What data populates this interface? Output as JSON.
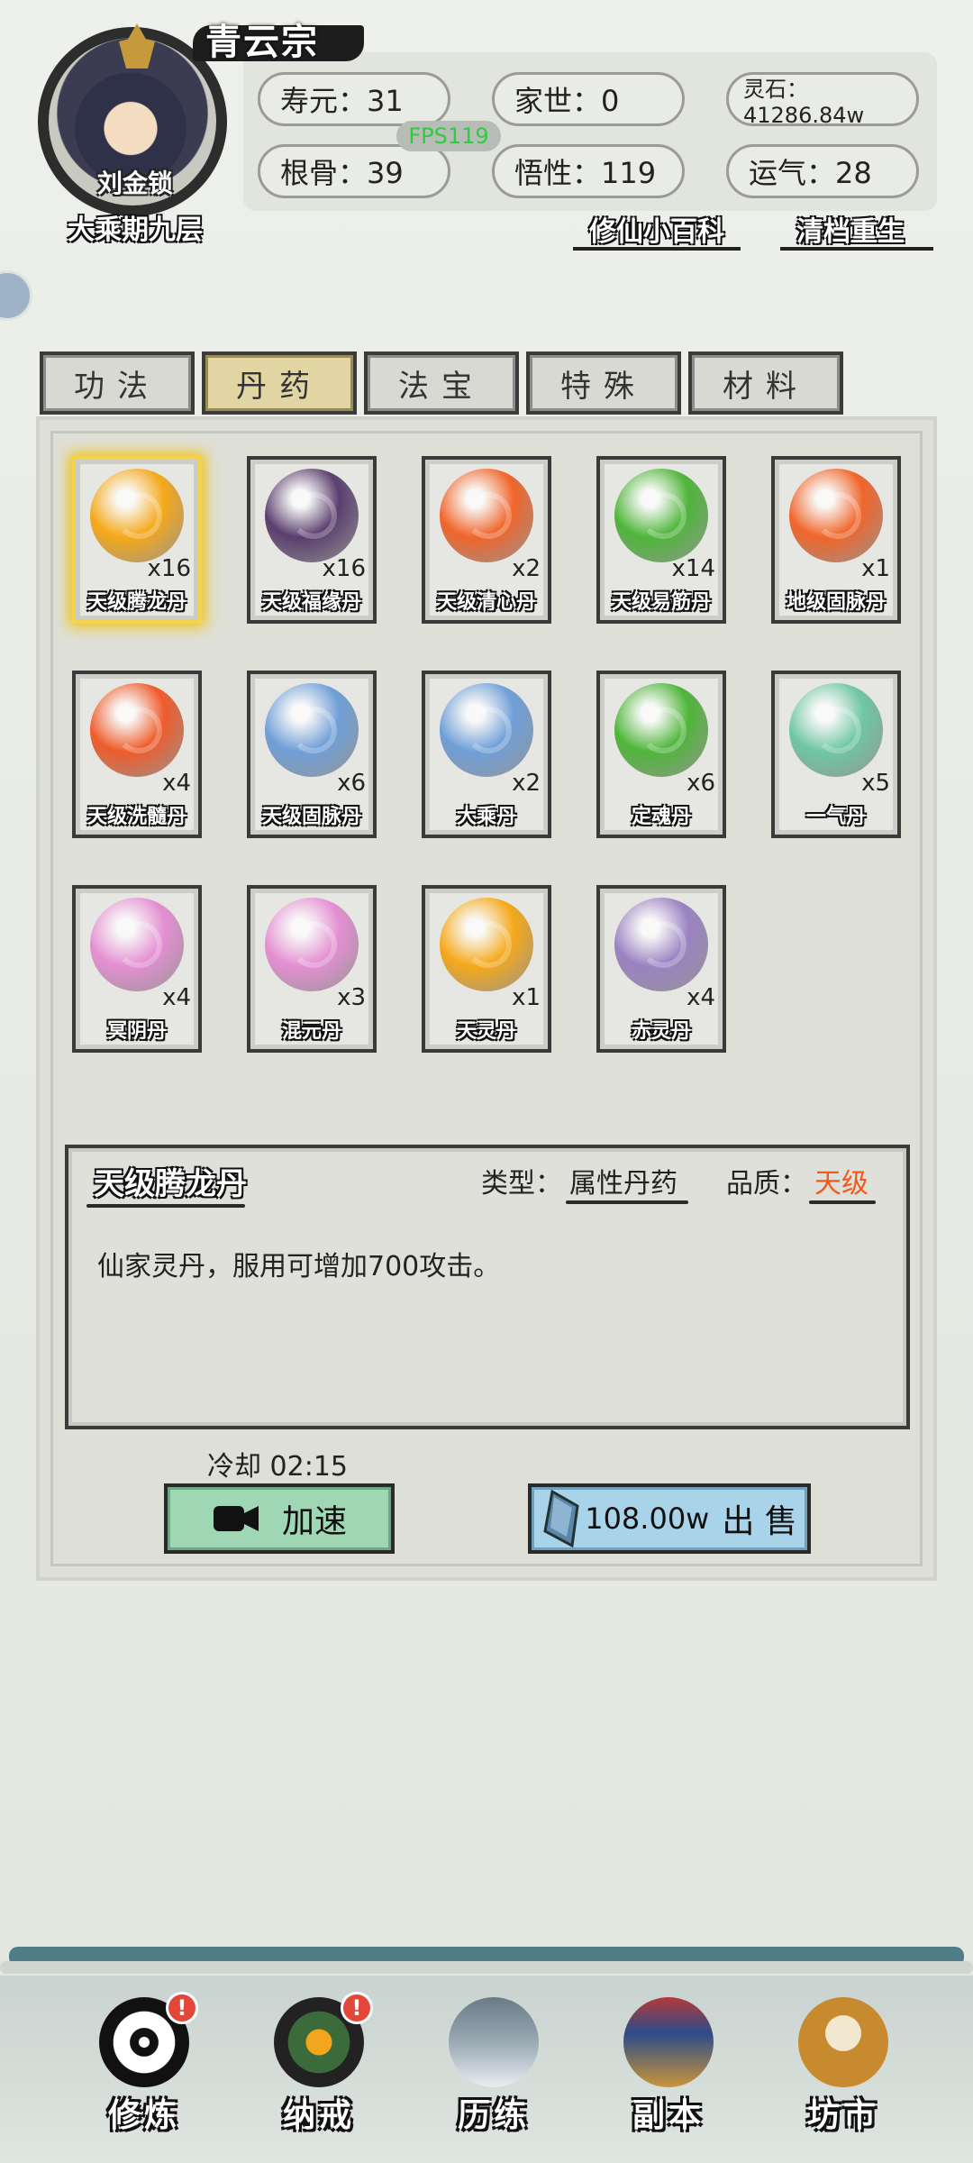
{
  "player": {
    "sect": "青云宗",
    "name": "刘金锁",
    "realm": "大乘期九层",
    "stats": {
      "lifespan": "寿元：31",
      "family": "家世：0",
      "spirit_stone": "灵石：41286.84w",
      "root": "根骨：39",
      "insight": "悟性：119",
      "luck": "运气：28"
    },
    "fps": "FPS119"
  },
  "links": {
    "encyclopedia": "修仙小百科",
    "reset": "清档重生"
  },
  "tabs": [
    "功法",
    "丹药",
    "法宝",
    "特殊",
    "材料"
  ],
  "active_tab": "丹药",
  "items": [
    {
      "name": "天级腾龙丹",
      "qty": "x16",
      "color": "#f5a81a"
    },
    {
      "name": "天级福缘丹",
      "qty": "x16",
      "color": "#5a3f6e"
    },
    {
      "name": "天级清心丹",
      "qty": "x2",
      "color": "#f0652a"
    },
    {
      "name": "天级易筋丹",
      "qty": "x14",
      "color": "#4fb53a"
    },
    {
      "name": "地级固脉丹",
      "qty": "x1",
      "color": "#f0652a"
    },
    {
      "name": "天级洗髓丹",
      "qty": "x4",
      "color": "#ef5b2b"
    },
    {
      "name": "天级固脉丹",
      "qty": "x6",
      "color": "#6f9fd8"
    },
    {
      "name": "大乘丹",
      "qty": "x2",
      "color": "#6f9fd8"
    },
    {
      "name": "定魂丹",
      "qty": "x6",
      "color": "#4fb53a"
    },
    {
      "name": "一气丹",
      "qty": "x5",
      "color": "#6fc6a6"
    },
    {
      "name": "冥阴丹",
      "qty": "x4",
      "color": "#e48fd2"
    },
    {
      "name": "混元丹",
      "qty": "x3",
      "color": "#e48fd2"
    },
    {
      "name": "天灵丹",
      "qty": "x1",
      "color": "#f5a81a"
    },
    {
      "name": "赤灵丹",
      "qty": "x4",
      "color": "#9a82c2"
    }
  ],
  "detail": {
    "title": "天级腾龙丹",
    "type_label": "类型：",
    "type_value": "属性丹药",
    "quality_label": "品质：",
    "quality_value": "天级",
    "description": "仙家灵丹，服用可增加700攻击。"
  },
  "cooldown": "冷却 02:15",
  "speed_button": "加速",
  "sell_button": {
    "price": "108.00w",
    "label": "出 售"
  },
  "nav": [
    {
      "label": "修炼",
      "icon": "taiji-icon",
      "badge": "!"
    },
    {
      "label": "纳戒",
      "icon": "ring-icon",
      "badge": "!"
    },
    {
      "label": "历练",
      "icon": "mountain-icon",
      "badge": ""
    },
    {
      "label": "副本",
      "icon": "pagoda-icon",
      "badge": ""
    },
    {
      "label": "坊市",
      "icon": "cauldron-icon",
      "badge": ""
    }
  ]
}
